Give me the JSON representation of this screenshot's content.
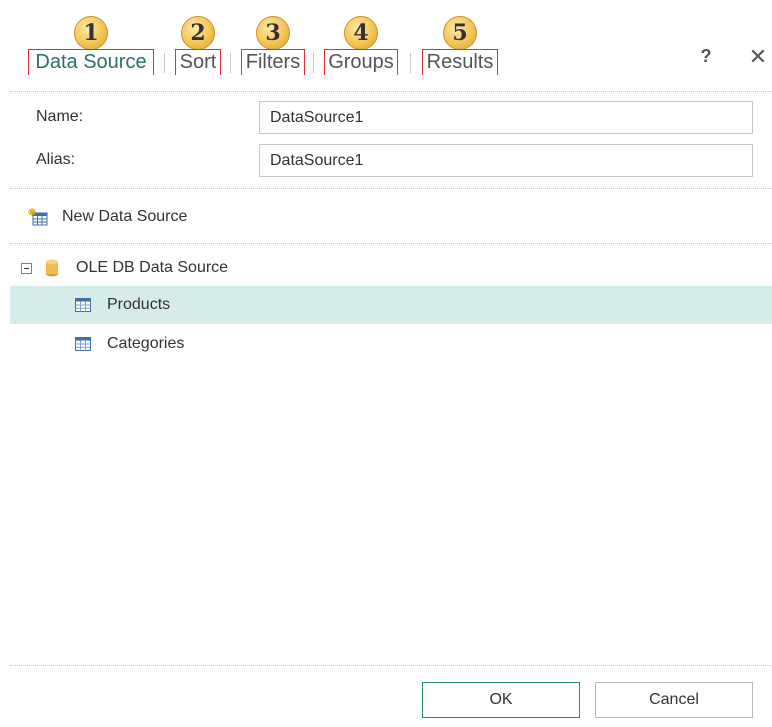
{
  "tabs": [
    {
      "number": "1",
      "label": "Data Source",
      "active": true
    },
    {
      "number": "2",
      "label": "Sort",
      "active": false
    },
    {
      "number": "3",
      "label": "Filters",
      "active": false
    },
    {
      "number": "4",
      "label": "Groups",
      "active": false
    },
    {
      "number": "5",
      "label": "Results",
      "active": false
    }
  ],
  "header": {
    "help_symbol": "?",
    "close_symbol": "✕"
  },
  "form": {
    "name_label": "Name:",
    "name_value": "DataSource1",
    "alias_label": "Alias:",
    "alias_value": "DataSource1"
  },
  "toolbar": {
    "new_data_source_label": "New Data Source",
    "icon": "new-data-source-icon"
  },
  "tree": {
    "root": {
      "label": "OLE DB Data Source",
      "icon": "database-icon",
      "expanded": true
    },
    "children": [
      {
        "label": "Products",
        "icon": "table-icon",
        "selected": true
      },
      {
        "label": "Categories",
        "icon": "table-icon",
        "selected": false
      }
    ]
  },
  "footer": {
    "ok_label": "OK",
    "cancel_label": "Cancel"
  },
  "colors": {
    "accent": "#2e8b7a",
    "active_tab_text": "#2e6e6a",
    "selected_row": "#d6ecea",
    "marker_red": "#e03030",
    "badge_gold": "#f5c454"
  }
}
